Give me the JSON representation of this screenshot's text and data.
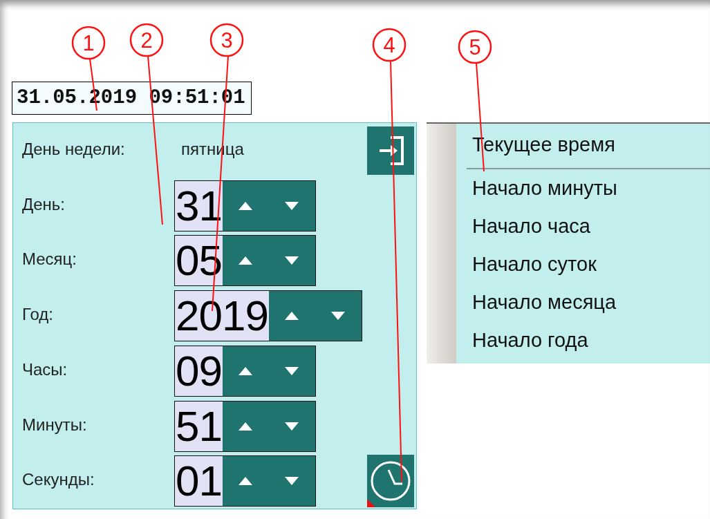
{
  "callouts": [
    "1",
    "2",
    "3",
    "4",
    "5"
  ],
  "date_field": {
    "value": "31.05.2019 09:51:01"
  },
  "panel": {
    "weekday_label": "День недели:",
    "weekday_value": "пятница",
    "fields": [
      {
        "label": "День:",
        "value": "31"
      },
      {
        "label": "Месяц:",
        "value": "05"
      },
      {
        "label": "Год:",
        "value": "2019"
      },
      {
        "label": "Часы:",
        "value": "09"
      },
      {
        "label": "Минуты:",
        "value": "51"
      },
      {
        "label": "Секунды:",
        "value": "01"
      }
    ]
  },
  "menu": {
    "items": [
      {
        "label": "Текущее время",
        "kind": "header"
      },
      {
        "label": "Начало минуты",
        "kind": "item"
      },
      {
        "label": "Начало часа",
        "kind": "item"
      },
      {
        "label": "Начало суток",
        "kind": "item"
      },
      {
        "label": "Начало месяца",
        "kind": "item"
      },
      {
        "label": "Начало года",
        "kind": "item"
      }
    ]
  }
}
